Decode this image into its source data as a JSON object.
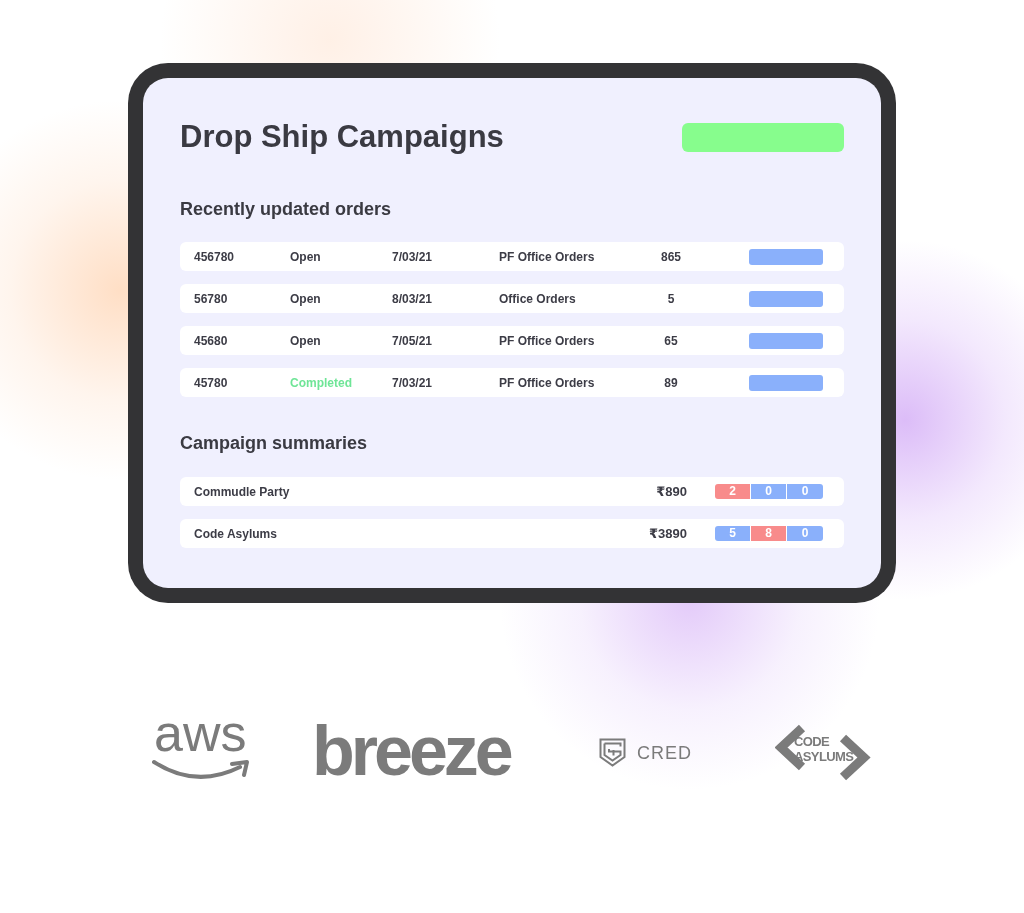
{
  "header": {
    "title": "Drop Ship Campaigns"
  },
  "orders": {
    "heading": "Recently updated orders",
    "rows": [
      {
        "id": "456780",
        "status": "Open",
        "completed": false,
        "date": "7/03/21",
        "name": "PF Office Orders",
        "count": "865"
      },
      {
        "id": "56780",
        "status": "Open",
        "completed": false,
        "date": "8/03/21",
        "name": "Office Orders",
        "count": "5"
      },
      {
        "id": "45680",
        "status": "Open",
        "completed": false,
        "date": "7/05/21",
        "name": "PF Office Orders",
        "count": "65"
      },
      {
        "id": "45780",
        "status": "Completed",
        "completed": true,
        "date": "7/03/21",
        "name": "PF Office Orders",
        "count": "89"
      }
    ]
  },
  "summaries": {
    "heading": "Campaign summaries",
    "rows": [
      {
        "name": "Commudle Party",
        "amount": "₹890",
        "counts": [
          {
            "value": "2",
            "color": "#f88b8b"
          },
          {
            "value": "0",
            "color": "#8ab0fb"
          },
          {
            "value": "0",
            "color": "#8ab0fb"
          }
        ]
      },
      {
        "name": "Code Asylums",
        "amount": "₹3890",
        "counts": [
          {
            "value": "5",
            "color": "#8ab0fb"
          },
          {
            "value": "8",
            "color": "#f88b8b"
          },
          {
            "value": "0",
            "color": "#8ab0fb"
          }
        ]
      }
    ]
  },
  "logos": [
    {
      "kind": "smile",
      "text": "aws"
    },
    {
      "kind": "plain",
      "text": "breeze"
    },
    {
      "kind": "shield",
      "text": "CRED"
    },
    {
      "kind": "brackets",
      "lines": [
        "CODE",
        "ASYLUMS"
      ]
    }
  ]
}
